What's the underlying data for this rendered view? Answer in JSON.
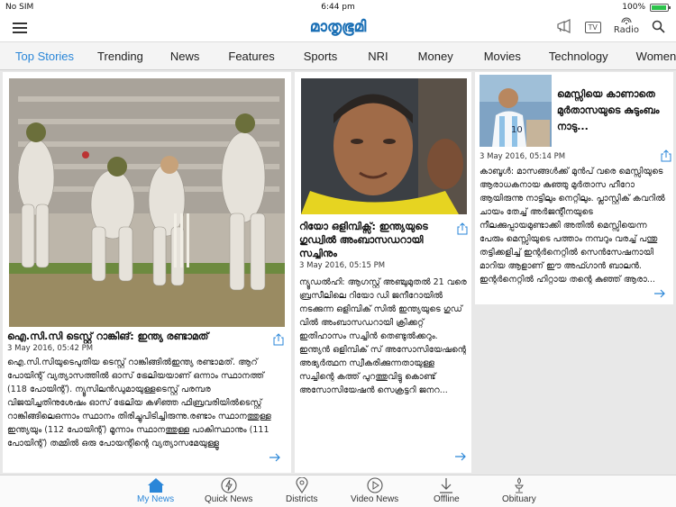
{
  "status_bar": {
    "carrier": "No SIM",
    "time": "6:44 pm",
    "battery": "100%"
  },
  "header": {
    "logo": "മാതൃഭൂമി",
    "tv_label": "TV",
    "radio_label": "Radio"
  },
  "tabs": [
    {
      "label": "Top Stories",
      "active": true
    },
    {
      "label": "Trending"
    },
    {
      "label": "News"
    },
    {
      "label": "Features"
    },
    {
      "label": "Sports"
    },
    {
      "label": "NRI"
    },
    {
      "label": "Money"
    },
    {
      "label": "Movies"
    },
    {
      "label": "Technology"
    },
    {
      "label": "Women"
    }
  ],
  "articles": [
    {
      "headline": "ഐ.സി.സി ടെസ്റ്റ് റാങ്കിങ്: ഇന്ത്യ രണ്ടാമത്",
      "date": "3 May 2016, 05:42 PM",
      "body": "ഐ.സി.സിയുടെപുതിയ ടെസ്റ്റ് റാങ്കിങ്ങിൽഇന്ത്യ രണ്ടാമത്. ആറ് പോയിന്റ് വ്യത്യാസത്തിൽ ഓസ് ട്രേലിയയാണ് ഒന്നാം സ്ഥാനത്ത് (118 പോയിന്റ്). ന്യൂസിലൻഡുമായുള്ളടെസ്റ്റ് പരമ്പര വിജയിച്ചതിനുശേഷം ഓസ് ട്രേലിയ കഴിഞ്ഞ ഫിബ്രവരിയിൽടെസ്റ്റ് റാങ്കിങ്ങിലെഒന്നാം സ്ഥാനം തിരിച്ചുപിടിച്ചിരുന്നു.രണ്ടാം സ്ഥാനത്തുള്ള ഇന്ത്യയും (112 പോയിന്റ്) മൂന്നാം സ്ഥാനത്തുള്ള പാകിസ്ഥാനും (111 പോയിന്റ്) തമ്മിൽ ഒരു പോയന്റിന്റെ വ്യത്യാസമേയുള്ളൂ"
    },
    {
      "headline": "റിയോ ഒളിമ്പിക്സ്: ഇന്ത്യയുടെ ഗുഡ്വിൽ അംബാസഡറായി സച്ചിനും",
      "date": "3 May 2016, 05:15 PM",
      "body": "ന്യൂഡൽഹി: ആഗസ്റ്റ് അഞ്ചുമുതൽ 21 വരെ ബ്രസീലിലെ റിയോ ഡി ജനീറോയിൽ നടക്കുന്ന ഒളിമ്പിക് സിൽ ഇന്ത്യയുടെ ഗുഡ് വിൽ അംബാസഡറായി ക്രിക്കറ്റ് ഇതിഹാസം സച്ചിൻ തെണ്ടുൽക്കറും. ഇന്ത്യൻ ഒളിമ്പിക് സ് അസോസിയേഷന്റെ അഭ്യർത്ഥന സ്വീകരിക്കുന്നതായുള്ള സച്ചിന്റെ കത്ത് പുറത്തുവിട്ടു കൊണ്ട് അസോസിയേഷൻ സെക്രട്ടറി ജനറ..."
    },
    {
      "headline": "മെസ്സിയെ കാണാതെ മുർതാസയുടെ കുടുംബം നാടു...",
      "date": "3 May 2016, 05:14 PM",
      "body": "കാബൂൾ: മാസങ്ങൾക്ക് മുൻപ് വരെ മെസ്സിയുടെ ആരാധകനായ കുഞ്ഞു മുർതാസ ഹീറോ ആയിരുന്നു നാട്ടിലും നെറ്റിലും. പ്ലാസ്റ്റിക് കവറിൽ ചായം തേച്ച് അർജന്റീനയുടെ നീലക്കുപ്പായമുണ്ടാക്കി അതിൽ മെസ്സിയെന്ന പേരും മെസ്സിയുടെ പത്താം നമ്പറും വരച്ച് പന്തു തട്ടിക്കളിച്ച് ഇന്റർനെറ്റിൽ സെൻസേഷനായി മാറിയ ആളാണ് ഈ അഫ്ഗാൻ ബാലൻ. ഇന്റർനെറ്റിൽ ഹിറ്റായ തന്റെ കുഞ്ഞ് ആരാ..."
    }
  ],
  "bottom_nav": [
    {
      "label": "My News",
      "icon": "home-icon",
      "active": true
    },
    {
      "label": "Quick News",
      "icon": "lightning-icon"
    },
    {
      "label": "Districts",
      "icon": "map-pin-icon"
    },
    {
      "label": "Video News",
      "icon": "play-icon"
    },
    {
      "label": "Offline",
      "icon": "download-icon"
    },
    {
      "label": "Obituary",
      "icon": "lamp-icon"
    }
  ],
  "colors": {
    "accent": "#2a86d8",
    "logo": "#1a6fb5",
    "pitch_green": "#5f7d3a"
  }
}
